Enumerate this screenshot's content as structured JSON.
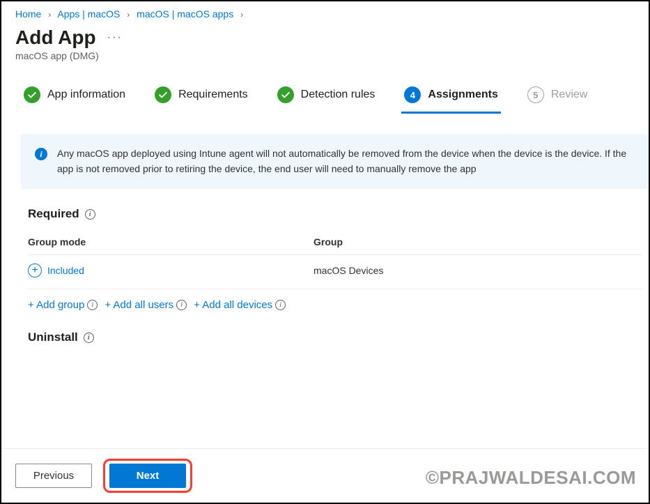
{
  "breadcrumb": {
    "items": [
      {
        "label": "Home"
      },
      {
        "label": "Apps | macOS"
      },
      {
        "label": "macOS | macOS apps"
      }
    ]
  },
  "header": {
    "title": "Add App",
    "subtitle": "macOS app (DMG)"
  },
  "stepper": {
    "steps": [
      {
        "label": "App information",
        "state": "done"
      },
      {
        "label": "Requirements",
        "state": "done"
      },
      {
        "label": "Detection rules",
        "state": "done"
      },
      {
        "label": "Assignments",
        "state": "active",
        "num": "4"
      },
      {
        "label": "Review",
        "state": "disabled",
        "num": "5"
      }
    ]
  },
  "banner": {
    "text": "Any macOS app deployed using Intune agent will not automatically be removed from the device when the device is the device. If the app is not removed prior to retiring the device, the end user will need to manually remove the app"
  },
  "required": {
    "title": "Required",
    "columns": {
      "mode": "Group mode",
      "group": "Group"
    },
    "rows": [
      {
        "mode": "Included",
        "group": "macOS Devices"
      }
    ],
    "actions": {
      "add_group": "+ Add group",
      "add_all_users": "+ Add all users",
      "add_all_devices": "+ Add all devices"
    }
  },
  "uninstall": {
    "title": "Uninstall"
  },
  "footer": {
    "previous": "Previous",
    "next": "Next"
  },
  "watermark": "©PRAJWALDESAI.COM"
}
